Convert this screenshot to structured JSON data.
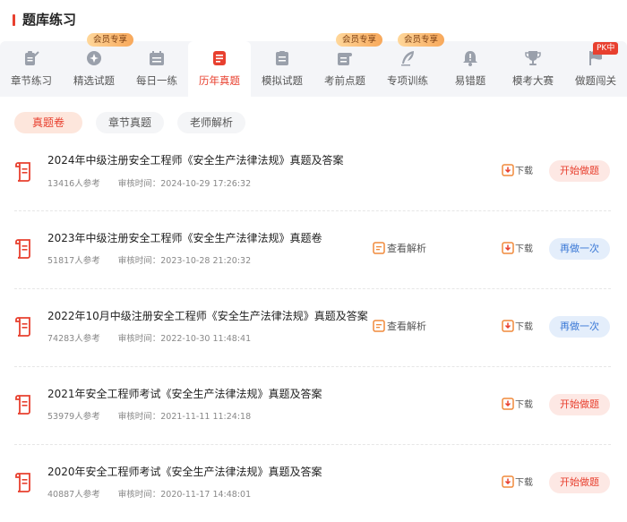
{
  "header": {
    "title": "题库练习"
  },
  "tabs": [
    {
      "label": "章节练习",
      "icon": "chapter-practice-icon",
      "badge": ""
    },
    {
      "label": "精选试题",
      "icon": "featured-questions-icon",
      "badge": "会员专享"
    },
    {
      "label": "每日一练",
      "icon": "daily-practice-icon",
      "badge": ""
    },
    {
      "label": "历年真题",
      "icon": "past-exams-icon",
      "badge": "",
      "active": true
    },
    {
      "label": "模拟试题",
      "icon": "mock-exam-icon",
      "badge": ""
    },
    {
      "label": "考前点题",
      "icon": "pre-exam-tips-icon",
      "badge": "会员专享"
    },
    {
      "label": "专项训练",
      "icon": "special-training-icon",
      "badge": "会员专享"
    },
    {
      "label": "易错题",
      "icon": "error-prone-icon",
      "badge": ""
    },
    {
      "label": "模考大赛",
      "icon": "trophy-icon",
      "badge": ""
    },
    {
      "label": "做题闯关",
      "icon": "flag-icon",
      "badge": "PK中"
    }
  ],
  "filters": [
    "真题卷",
    "章节真题",
    "老师解析"
  ],
  "list": [
    {
      "title": "2024年中级注册安全工程师《安全生产法律法规》真题及答案",
      "participants": "13416人参考",
      "review": "审核时间：2024-10-29 17:26:32",
      "analysis": "",
      "download": "下载",
      "action": "开始做题",
      "action_type": "start"
    },
    {
      "title": "2023年中级注册安全工程师《安全生产法律法规》真题卷",
      "participants": "51817人参考",
      "review": "审核时间：2023-10-28 21:20:32",
      "analysis": "查看解析",
      "download": "下载",
      "action": "再做一次",
      "action_type": "redo"
    },
    {
      "title": "2022年10月中级注册安全工程师《安全生产法律法规》真题及答案",
      "participants": "74283人参考",
      "review": "审核时间：2022-10-30 11:48:41",
      "analysis": "查看解析",
      "download": "下载",
      "action": "再做一次",
      "action_type": "redo"
    },
    {
      "title": "2021年安全工程师考试《安全生产法律法规》真题及答案",
      "participants": "53979人参考",
      "review": "审核时间：2021-11-11 11:24:18",
      "analysis": "",
      "download": "下载",
      "action": "开始做题",
      "action_type": "start"
    },
    {
      "title": "2020年安全工程师考试《安全生产法律法规》真题及答案",
      "participants": "40887人参考",
      "review": "审核时间：2020-11-17 14:48:01",
      "analysis": "",
      "download": "下载",
      "action": "开始做题",
      "action_type": "start"
    }
  ],
  "colors": {
    "accent": "#e8402f",
    "redo": "#3a78d6",
    "badge": "#f7a85b",
    "analysis": "#f08a3c"
  }
}
